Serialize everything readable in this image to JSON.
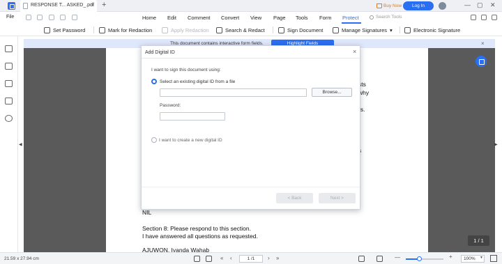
{
  "window": {
    "tab_title": "RESPONSE T... ASKED_.pdf",
    "tab_close": "×",
    "new_tab": "+",
    "buy_now": "Buy Now",
    "login": "Log In",
    "minimize": "—",
    "maximize": "▢",
    "close": "✕"
  },
  "menu": {
    "file": "File",
    "items": [
      "Home",
      "Edit",
      "Comment",
      "Convert",
      "View",
      "Page",
      "Tools",
      "Form",
      "Protect"
    ],
    "active": "Protect",
    "search_placeholder": "Search Tools"
  },
  "toolbar": {
    "items": [
      {
        "label": "Set Password",
        "icon": "lock-icon",
        "disabled": false
      },
      {
        "label": "Mark for Redaction",
        "icon": "redaction-mark-icon",
        "disabled": false
      },
      {
        "label": "Apply Redaction",
        "icon": "apply-redaction-icon",
        "disabled": true
      },
      {
        "label": "Search & Redact",
        "icon": "search-redact-icon",
        "disabled": false
      },
      {
        "label": "Sign Document",
        "icon": "sign-document-icon",
        "disabled": false
      },
      {
        "label": "Manage Signatures",
        "icon": "manage-signatures-icon",
        "disabled": false,
        "caret": "▾"
      },
      {
        "label": "Electronic Signature",
        "icon": "electronic-signature-icon",
        "disabled": false
      }
    ]
  },
  "banner": {
    "text": "This document contains interactive form fields.",
    "button": "Highlight Fields",
    "close": "×"
  },
  "document": {
    "fragments": [
      "sts",
      "why",
      "rs.",
      "s"
    ],
    "lines": [
      "NIL",
      "Section 8: Please respond to this section.",
      "I have answered all questions as requested.",
      "AJUWON, Iyanda Wahab"
    ]
  },
  "dialog": {
    "title": "Add Digital ID",
    "close": "×",
    "prompt": "I want to sign this document using:",
    "option_existing": "Select an existing digital ID from a file",
    "file_path_value": "",
    "browse": "Browse...",
    "password_label": "Password:",
    "password_value": "",
    "option_new": "I want to create a new digital ID",
    "back": "< Back",
    "next": "Next >"
  },
  "page_counter": "1 / 1",
  "status": {
    "dimensions": "21.59 x 27.94 cm",
    "page_input": "1 /1",
    "prev": "‹",
    "next": "›",
    "first": "«",
    "last": "»",
    "zoom_out": "—",
    "zoom_in": "+",
    "zoom_level": "100%",
    "zoom_fraction": 0.35
  }
}
